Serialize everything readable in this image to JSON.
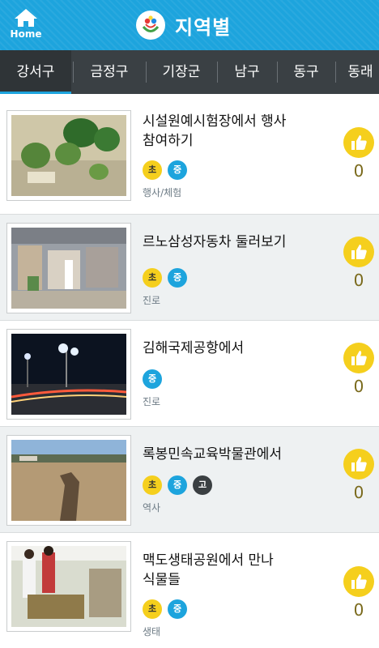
{
  "header": {
    "home_label": "Home",
    "title": "지역별"
  },
  "tabs": [
    "강서구",
    "금정구",
    "기장군",
    "남구",
    "동구",
    "동래"
  ],
  "active_tab": 0,
  "colors": {
    "header": "#1da4dd",
    "tabbar": "#3a4044",
    "badge_cho": "#f5cf1d",
    "badge_jung": "#1da4dd",
    "badge_go": "#3a3f42",
    "like": "#f5cf1d"
  },
  "items": [
    {
      "title_line1": "시설원예시험장에서 행사",
      "title_line2": "참여하기",
      "badges": [
        "초",
        "중"
      ],
      "category": "행사/체험",
      "likes": "0"
    },
    {
      "title_line1": "르노삼성자동차 둘러보기",
      "title_line2": "",
      "badges": [
        "초",
        "중"
      ],
      "category": "진로",
      "likes": "0"
    },
    {
      "title_line1": "김해국제공항에서",
      "title_line2": "",
      "badges": [
        "중"
      ],
      "category": "진로",
      "likes": "0"
    },
    {
      "title_line1": "록봉민속교육박물관에서",
      "title_line2": "",
      "badges": [
        "초",
        "중",
        "고"
      ],
      "category": "역사",
      "likes": "0"
    },
    {
      "title_line1": "맥도생태공원에서 만나",
      "title_line2": "식물들",
      "badges": [
        "초",
        "중"
      ],
      "category": "생태",
      "likes": "0"
    }
  ]
}
